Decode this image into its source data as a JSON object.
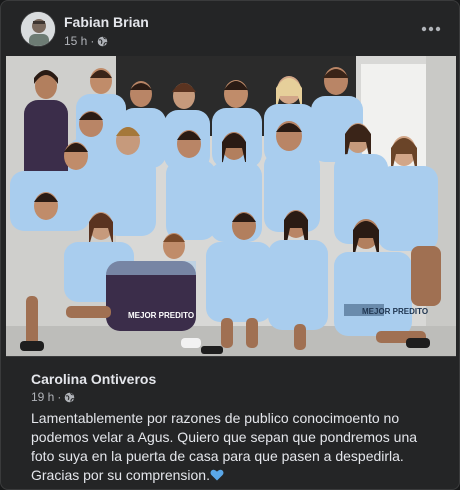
{
  "post": {
    "author": "Fabian Brian",
    "time": "15 h",
    "separator": "·",
    "audience_icon": "globe-icon",
    "more_icon": "more-options-icon"
  },
  "photo": {
    "subject": "team-photo",
    "jersey_text": [
      "MEJOR PREDITO",
      "MEJOR PREDITO"
    ],
    "colors": {
      "jersey": "#a9cdee",
      "background": "#d8d8d6",
      "dark_wall": "#2b2b2b"
    }
  },
  "shared": {
    "author": "Carolina Ontiveros",
    "time": "19 h",
    "separator": "·",
    "text": "Lamentablemente por razones de publico conocimoento no podemos velar a Agus. Quiero que sepan que pondremos una foto suya en la puerta de casa para que pasen a despedirla. Gracias por su comprension.",
    "emoji": "blue-heart-icon"
  },
  "colors": {
    "card": "#242526",
    "text": "#e4e6eb",
    "secondary": "#b0b3b8",
    "heart": "#5aa7e8"
  }
}
